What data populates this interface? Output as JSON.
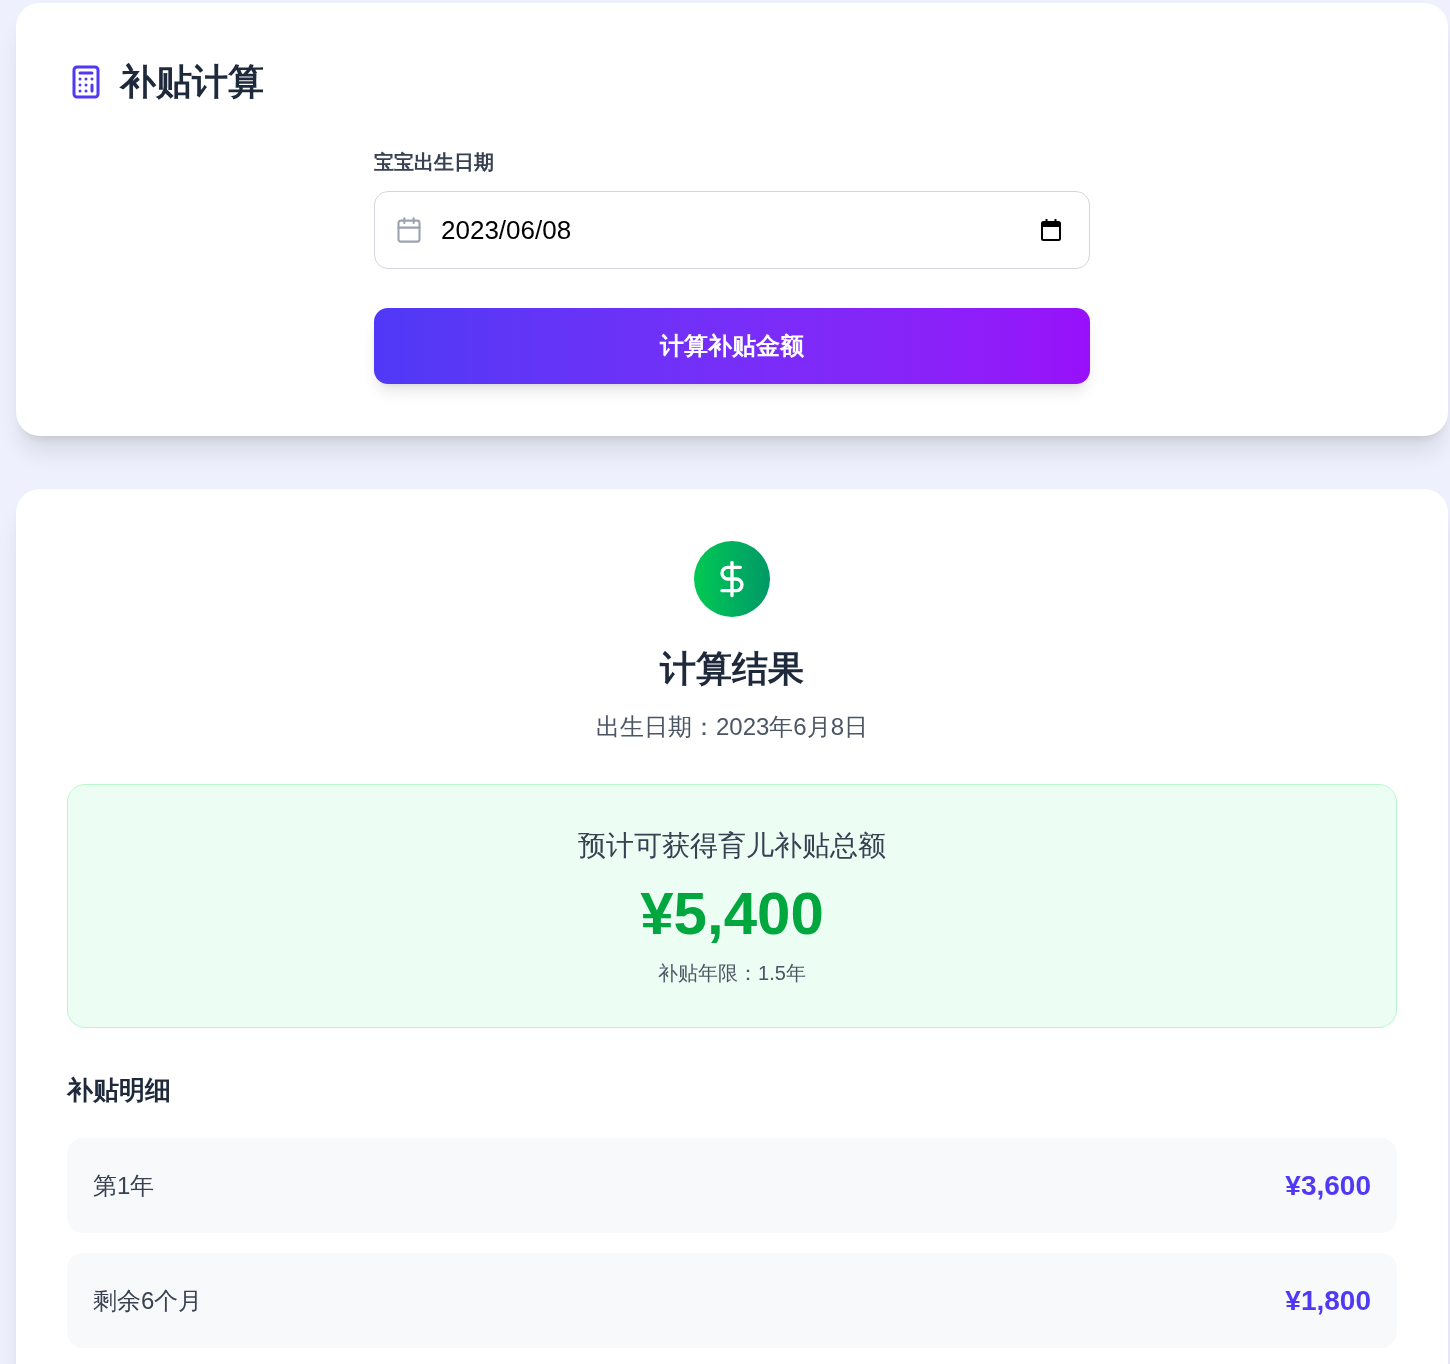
{
  "calculator": {
    "title": "补贴计算",
    "birth_date_field": {
      "label": "宝宝出生日期",
      "value": "2023/06/08"
    },
    "calculate_button": "计算补贴金额"
  },
  "result": {
    "title": "计算结果",
    "birth_date_text": "出生日期：2023年6月8日",
    "total": {
      "label": "预计可获得育儿补贴总额",
      "amount": "¥5,400",
      "duration": "补贴年限：1.5年"
    },
    "breakdown": {
      "title": "补贴明细",
      "rows": [
        {
          "label": "第1年",
          "amount": "¥3,600"
        },
        {
          "label": "剩余6个月",
          "amount": "¥1,800"
        }
      ]
    }
  }
}
